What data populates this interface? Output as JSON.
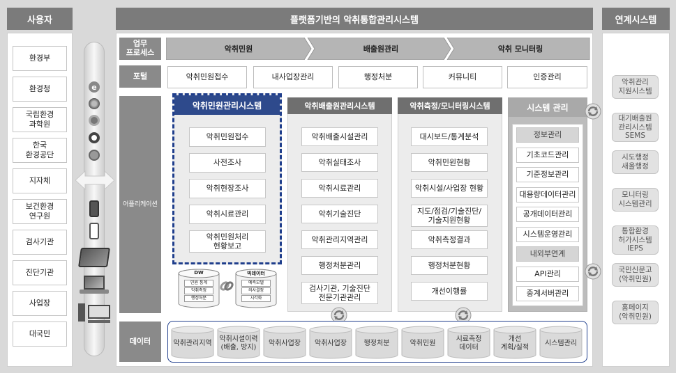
{
  "headers": {
    "users": "사용자",
    "main": "플랫폼기반의 악취통합관리시스템",
    "linked": "연계시스템"
  },
  "users": [
    "환경부",
    "환경청",
    "국립환경\n과학원",
    "한국\n환경공단",
    "지자체",
    "보건환경\n연구원",
    "검사기관",
    "진단기관",
    "사업장",
    "대국민"
  ],
  "row_labels": {
    "process": "업무\n프로세스",
    "portal": "포털",
    "application": "어플리케이션",
    "data": "데이터"
  },
  "process_steps": [
    "악취민원",
    "배출원관리",
    "악취 모니터링"
  ],
  "portal_items": [
    "악취민원접수",
    "내사업장관리",
    "행정처분",
    "커뮤니티",
    "인증관리"
  ],
  "systems": {
    "complaint": {
      "title": "악취민원관리시스템",
      "items": [
        "악취민원접수",
        "사전조사",
        "악취현장조사",
        "악취시료관리",
        "악취민원처리\n현황보고"
      ]
    },
    "emission": {
      "title": "악취배출원관리시스템",
      "items": [
        "악취배출시설관리",
        "악취실태조사",
        "악취시료관리",
        "악취기술진단",
        "악취관리지역관리",
        "행정처분관리",
        "검사기관, 기술진단\n전문기관관리"
      ]
    },
    "monitoring": {
      "title": "악취측정/모니터링시스템",
      "items": [
        "대시보드/통계분석",
        "악취민원현황",
        "악취시설/사업장 현황",
        "지도/점검/기술진단/\n기술지원현황",
        "악취측정결과",
        "행정처분현황",
        "개선이행률"
      ]
    },
    "sysmgmt": {
      "title": "시스템 관리",
      "items": [
        "정보관리",
        "기초코드관리",
        "기준정보관리",
        "대용량데이터관리",
        "공개데이터관리",
        "시스템운영관리",
        "내외부연계",
        "API관리",
        "중계서버관리"
      ],
      "group_headers": [
        0,
        6
      ]
    }
  },
  "databases": {
    "dw": {
      "title": "DW",
      "items": [
        "민원 통계",
        "악취측정",
        "행정처분"
      ]
    },
    "bigdata": {
      "title": "빅데이터",
      "items": [
        "예측모델",
        "의사결정",
        "시각화"
      ]
    }
  },
  "data_items": [
    "악취관리지역",
    "악취시설이력\n(배출, 방지)",
    "악취사업장",
    "악취사업장",
    "행정처분",
    "악취민원",
    "시료측정\n데이터",
    "개선\n계획/실적",
    "시스템관리"
  ],
  "linked_systems": [
    "악취관리\n지원시스템",
    "대기배출원\n관리시스템\nSEMS",
    "시도행정\n새올행정",
    "모니터링\n시스템관리",
    "통합환경\n허가시스템\nIEPS",
    "국민신문고\n(악취민원)",
    "홈페이지\n(악취민원)"
  ],
  "colors": {
    "header_gray": "#7b7b7b",
    "panel_gray": "#ececec",
    "highlight_blue": "#1f3e8c"
  }
}
